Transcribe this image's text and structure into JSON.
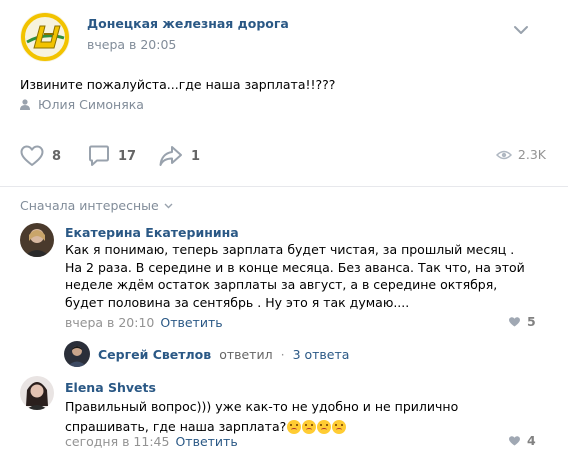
{
  "post": {
    "group_name": "Донецкая железная дорога",
    "time": "вчера в 20:05",
    "text": "Извините пожалуйста...где наша зарплата!!???",
    "signer": "Юлия Симоняка",
    "likes": "8",
    "comments": "17",
    "shares": "1",
    "views": "2.3K"
  },
  "comments_section": {
    "sort_label": "Сначала интересные",
    "items": [
      {
        "author": "Екатерина Екатеринина",
        "text": "Как я понимаю, теперь зарплата будет чистая, за прошлый месяц . На 2 раза. В середине и в конце месяца. Без аванса. Так что, на этой неделе ждём остаток зарплаты за август, а в середине октября, будет половина за сентябрь . Ну это я так думаю....",
        "time": "вчера в 20:10",
        "reply_label": "Ответить",
        "likes": "5"
      },
      {
        "author": "Elena Shvets",
        "text": "Правильный вопрос))) уже как-то не удобно и не прилично спрашивать, где наша зарплата?",
        "time": "сегодня в 11:45",
        "reply_label": "Ответить",
        "likes": "4"
      }
    ],
    "thread": {
      "author": "Сергей Светлов",
      "verb": "ответил",
      "dot": "·",
      "count": "3 ответа"
    }
  },
  "colors": {
    "link": "#2a5885",
    "muted": "#818c99",
    "icon": "#99a2ad",
    "logo_yellow": "#f2c300",
    "logo_green": "#2f8f3e"
  },
  "icons": [
    "chevron-down-icon",
    "user-icon",
    "heart-icon",
    "comment-icon",
    "share-icon",
    "eye-icon"
  ]
}
